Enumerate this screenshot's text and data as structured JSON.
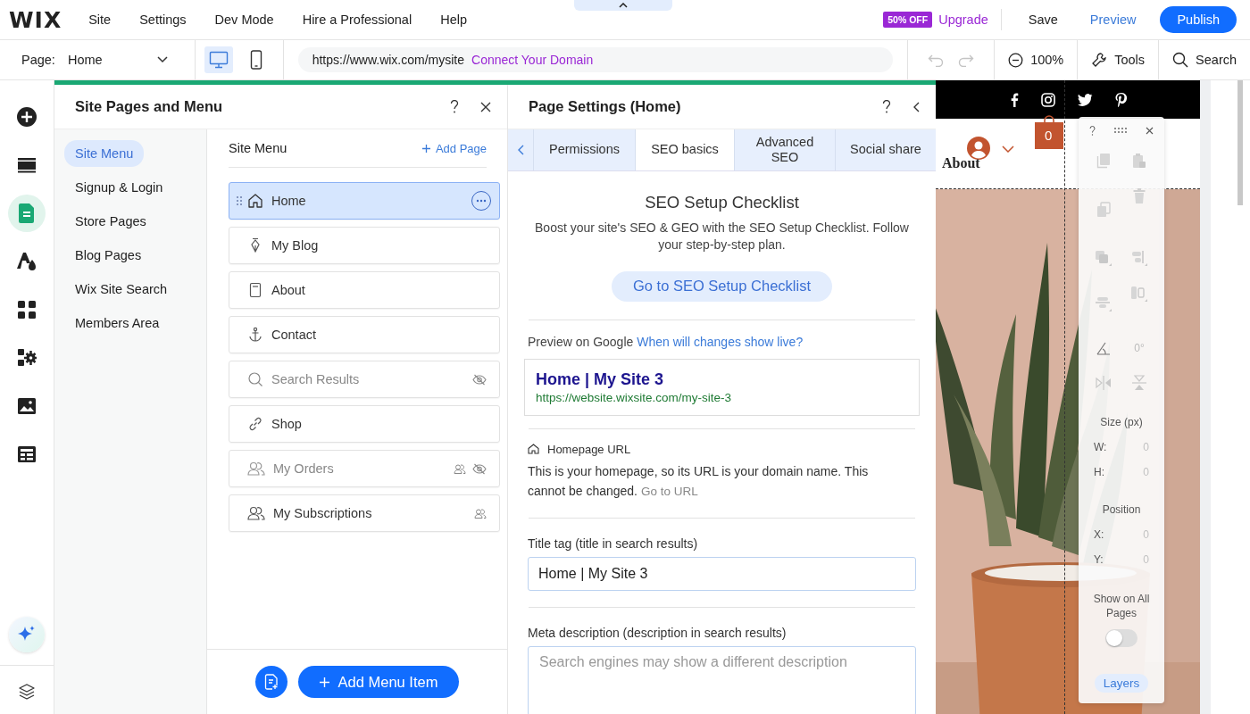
{
  "top_menu": {
    "logo": "WIX",
    "items": [
      "Site",
      "Settings",
      "Dev Mode",
      "Hire a Professional",
      "Help"
    ],
    "promo_badge": "50% OFF",
    "upgrade": "Upgrade",
    "save": "Save",
    "preview": "Preview",
    "publish": "Publish"
  },
  "toolbar": {
    "page_label": "Page:",
    "page_value": "Home",
    "devices": [
      {
        "kind": "desktop",
        "selected": true
      },
      {
        "kind": "mobile",
        "selected": false
      }
    ],
    "url": "https://www.wix.com/mysite",
    "connect_domain": "Connect Your Domain",
    "zoom": "100%",
    "tools": "Tools",
    "search": "Search"
  },
  "left_rail": [
    {
      "kind": "add",
      "selected": false
    },
    {
      "kind": "sections",
      "selected": false
    },
    {
      "kind": "pages",
      "selected": true
    },
    {
      "kind": "design",
      "selected": false
    },
    {
      "kind": "apps",
      "selected": false
    },
    {
      "kind": "business",
      "selected": false
    },
    {
      "kind": "media",
      "selected": false
    },
    {
      "kind": "cms",
      "selected": false
    }
  ],
  "site_pages_panel": {
    "title": "Site Pages and Menu",
    "categories": [
      {
        "label": "Site Menu",
        "selected": true
      },
      {
        "label": "Signup & Login",
        "selected": false
      },
      {
        "label": "Store Pages",
        "selected": false
      },
      {
        "label": "Blog Pages",
        "selected": false
      },
      {
        "label": "Wix Site Search",
        "selected": false
      },
      {
        "label": "Members Area",
        "selected": false
      }
    ],
    "menu_header": "Site Menu",
    "add_page": "Add Page",
    "pages": [
      {
        "label": "Home",
        "kind": "home",
        "selected": true,
        "hidden": false,
        "members_only": false
      },
      {
        "label": "My Blog",
        "kind": "blog",
        "selected": false,
        "hidden": false,
        "members_only": false
      },
      {
        "label": "About",
        "kind": "page",
        "selected": false,
        "hidden": false,
        "members_only": false
      },
      {
        "label": "Contact",
        "kind": "anchor",
        "selected": false,
        "hidden": false,
        "members_only": false
      },
      {
        "label": "Search Results",
        "kind": "search",
        "selected": false,
        "hidden": true,
        "members_only": false
      },
      {
        "label": "Shop",
        "kind": "link",
        "selected": false,
        "hidden": false,
        "members_only": false
      },
      {
        "label": "My Orders",
        "kind": "members",
        "selected": false,
        "hidden": true,
        "members_only": true
      },
      {
        "label": "My Subscriptions",
        "kind": "members",
        "selected": false,
        "hidden": false,
        "members_only": true
      }
    ],
    "add_menu_item": "Add Menu Item"
  },
  "page_settings": {
    "title": "Page Settings (Home)",
    "tabs": [
      {
        "label": "Permissions",
        "selected": false
      },
      {
        "label": "SEO basics",
        "selected": true
      },
      {
        "label": "Advanced SEO",
        "selected": false
      },
      {
        "label": "Social share",
        "selected": false
      }
    ],
    "checklist_title": "SEO Setup Checklist",
    "checklist_text": "Boost your site's SEO & GEO with the SEO Setup Checklist. Follow your step-by-step plan.",
    "checklist_button": "Go to SEO Setup Checklist",
    "preview_label": "Preview on Google",
    "preview_link": "When will changes show live?",
    "google_preview": {
      "title": "Home | My Site 3",
      "url": "https://website.wixsite.com/my-site-3"
    },
    "homepage_url_label": "Homepage URL",
    "homepage_url_text": "This is your homepage, so its URL is your domain name. This cannot be changed.",
    "go_to_url": "Go to URL",
    "title_tag_label": "Title tag (title in search results)",
    "title_tag_value": "Home | My Site 3",
    "meta_label": "Meta description (description in search results)",
    "meta_placeholder": "Search engines may show a different description"
  },
  "canvas": {
    "menu_item": "About",
    "cart_count": "0"
  },
  "floating_panel": {
    "rotation": "0°",
    "size_label": "Size (px)",
    "w_label": "W:",
    "w_value": "0",
    "h_label": "H:",
    "h_value": "0",
    "position_label": "Position",
    "x_label": "X:",
    "x_value": "0",
    "y_label": "Y:",
    "y_value": "0",
    "show_all_label": "Show on All Pages",
    "show_all_on": false,
    "layers": "Layers"
  }
}
